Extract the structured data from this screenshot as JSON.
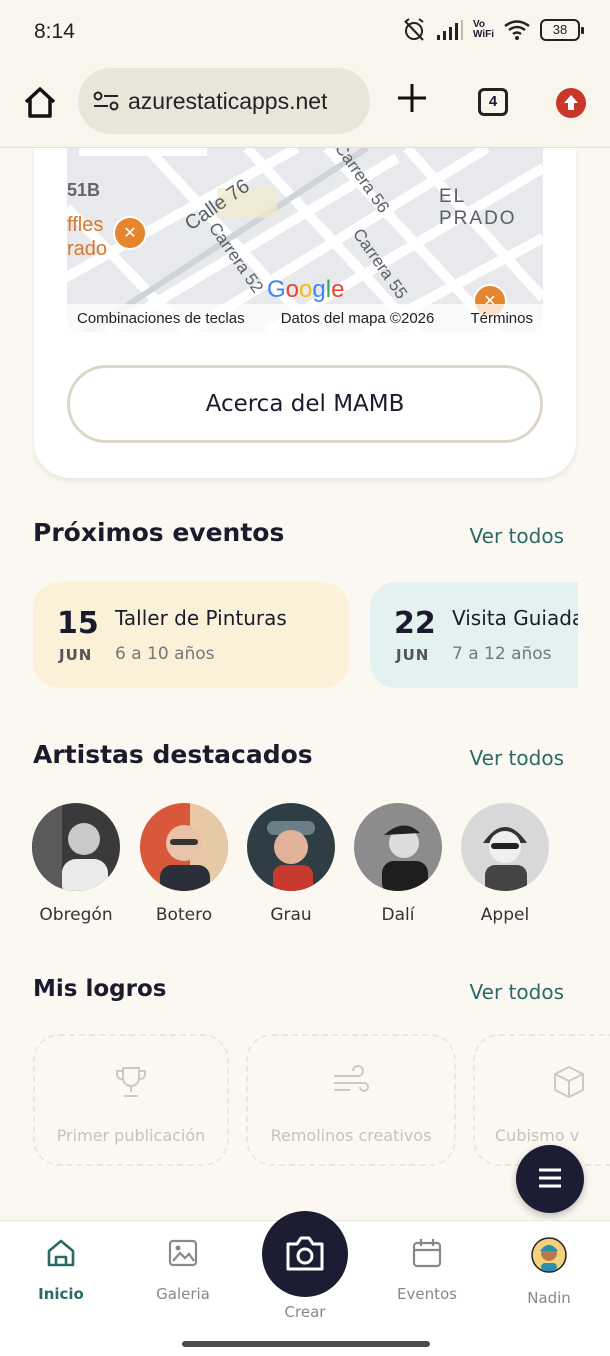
{
  "status_bar": {
    "time": "8:14",
    "battery": "38",
    "vowifi_top": "Vo",
    "vowifi_bottom": "WiFi"
  },
  "browser": {
    "url": "azurestaticapps.net",
    "tab_count": "4"
  },
  "map": {
    "labels": [
      "Calle 76",
      "Carrera 52",
      "Carrera 56",
      "Carrera 55",
      "EL PRADO",
      "ffles",
      "rado",
      "51B"
    ],
    "google": "Google",
    "footer": {
      "shortcuts": "Combinaciones de teclas",
      "map_data": "Datos del mapa ©2026",
      "terms": "Términos"
    }
  },
  "about_button": "Acerca del MAMB",
  "events": {
    "title": "Próximos eventos",
    "see_all": "Ver todos",
    "items": [
      {
        "day": "15",
        "month": "JUN",
        "title": "Taller de Pinturas",
        "age": "6 a 10 años",
        "color": "#fbf1d9"
      },
      {
        "day": "22",
        "month": "JUN",
        "title": "Visita Guiada",
        "age": "7 a 12 años",
        "color": "#e4f1f1"
      }
    ]
  },
  "artists": {
    "title": "Artistas destacados",
    "see_all": "Ver todos",
    "items": [
      {
        "name": "Obregón"
      },
      {
        "name": "Botero"
      },
      {
        "name": "Grau"
      },
      {
        "name": "Dalí"
      },
      {
        "name": "Appel"
      }
    ]
  },
  "achievements": {
    "title": "Mis logros",
    "see_all": "Ver todos",
    "items": [
      {
        "label": "Primer publicación",
        "icon": "trophy-icon"
      },
      {
        "label": "Remolinos creativos",
        "icon": "wind-icon"
      },
      {
        "label": "Cubismo v",
        "icon": "cube-icon"
      }
    ]
  },
  "bottom_nav": {
    "items": [
      {
        "label": "Inicio",
        "icon": "home-icon",
        "active": true
      },
      {
        "label": "Galeria",
        "icon": "image-icon"
      },
      {
        "label": "Crear",
        "icon": "camera-icon"
      },
      {
        "label": "Eventos",
        "icon": "calendar-icon"
      },
      {
        "label": "Nadin",
        "icon": "avatar-icon"
      }
    ]
  },
  "colors": {
    "accent": "#2b6a66",
    "dark": "#1c1d33",
    "background": "#fbf8f1",
    "pin": "#e5862f"
  }
}
